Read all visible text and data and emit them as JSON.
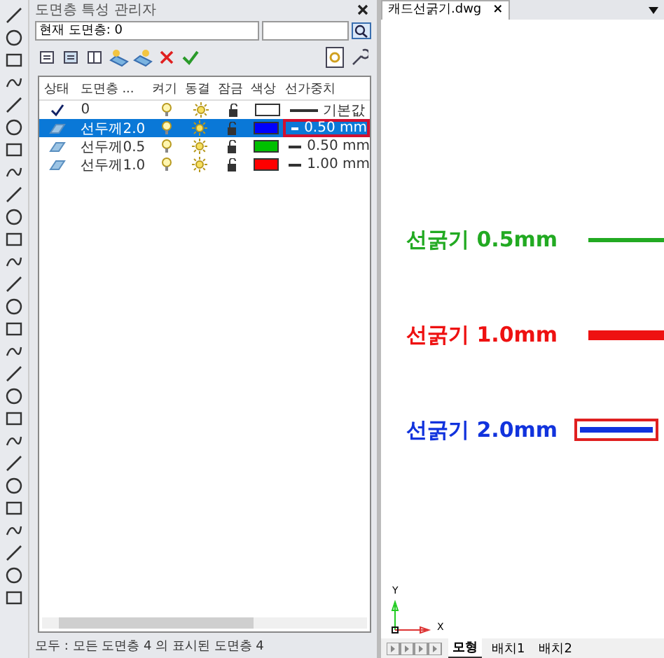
{
  "panel": {
    "title": "도면층 특성 관리자",
    "current_layer": "현재 도면층: 0"
  },
  "table": {
    "columns": [
      "상태",
      "도면층 ...",
      "켜기",
      "동결",
      "잠금",
      "색상",
      "선가중치"
    ],
    "rows": [
      {
        "current": true,
        "name": "0",
        "selected": false,
        "color": "#ffffff",
        "lineweight": "기본값",
        "highlighted": false
      },
      {
        "current": false,
        "name": "선두께2.0",
        "selected": true,
        "color": "#0000ff",
        "lineweight": "0.50 mm",
        "highlighted": true
      },
      {
        "current": false,
        "name": "선두께0.5",
        "selected": false,
        "color": "#00c000",
        "lineweight": "0.50 mm",
        "highlighted": false
      },
      {
        "current": false,
        "name": "선두께1.0",
        "selected": false,
        "color": "#ff0000",
        "lineweight": "1.00 mm",
        "highlighted": false
      }
    ]
  },
  "status_bar": "모두 : 모든 도면층 4 의 표시된 도면층 4",
  "document_tab": {
    "title": "캐드선굵기.dwg",
    "close": "×"
  },
  "drawing": {
    "items": [
      {
        "label": "선굵기 0.5mm",
        "color": "#22aa22",
        "kind": "thin",
        "highlighted": false
      },
      {
        "label": "선굵기 1.0mm",
        "color": "#ee1111",
        "kind": "thick",
        "highlighted": false
      },
      {
        "label": "선굵기 2.0mm",
        "color": "#1133dd",
        "kind": "medium",
        "highlighted": true
      }
    ],
    "axis_y": "Y",
    "axis_x": "X"
  },
  "layout_tabs": [
    {
      "label": "모형",
      "selected": true
    },
    {
      "label": "배치1",
      "selected": false
    },
    {
      "label": "배치2",
      "selected": false
    }
  ]
}
